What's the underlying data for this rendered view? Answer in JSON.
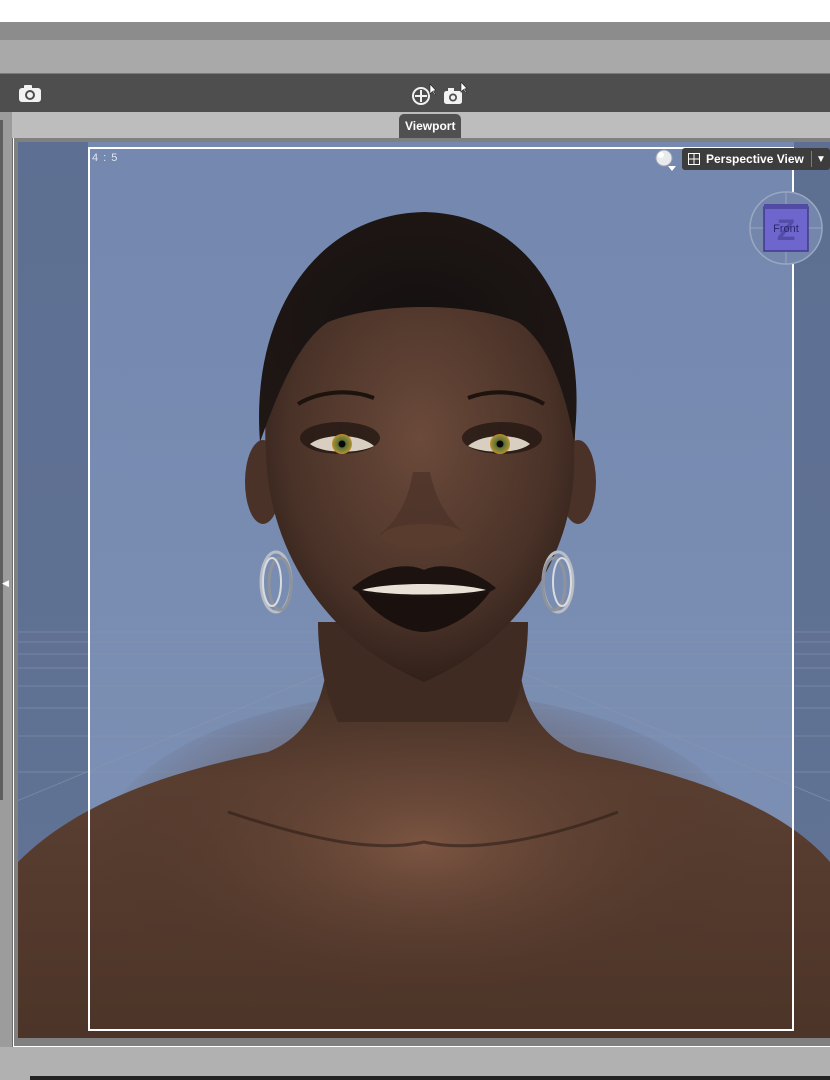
{
  "toolbar": {
    "camera_icon_left": "camera-icon",
    "center_icons": [
      "orbit-camera-icon",
      "camera-select-icon"
    ]
  },
  "tabs": [
    {
      "label": "Viewport",
      "active": true
    }
  ],
  "viewport": {
    "aspect_ratio_label": "4 : 5",
    "view_selector": {
      "label": "Perspective View"
    },
    "view_cube": {
      "face_label": "Front",
      "axis_label": "Z"
    },
    "scene_subject": "3D portrait render of a female figure with short hair and hoop earrings",
    "background_color": "#7486ab"
  }
}
